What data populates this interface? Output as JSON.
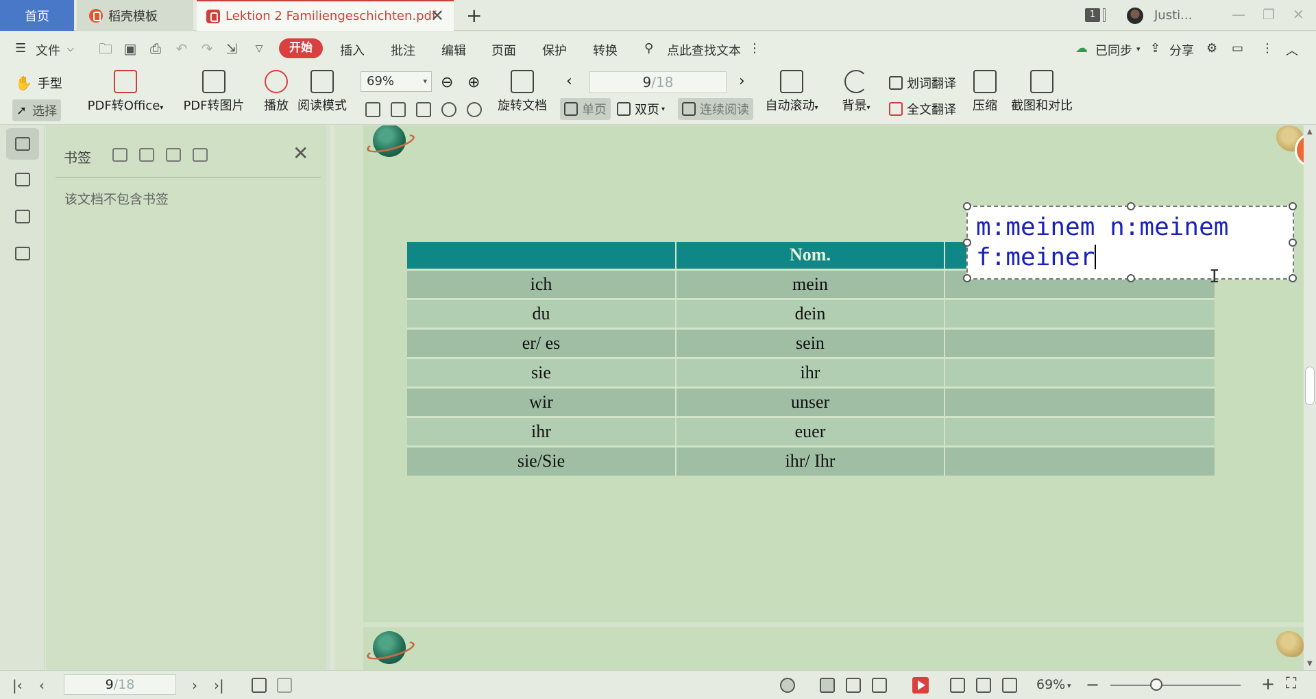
{
  "tabs": {
    "home": "首页",
    "templates": "稻壳模板",
    "document": "Lektion 2 Familiengeschichten.pdf"
  },
  "titlebar": {
    "window_count": "1",
    "user_name": "Justi..."
  },
  "menu": {
    "file": "文件",
    "start": "开始",
    "insert": "插入",
    "annotate": "批注",
    "edit": "编辑",
    "page": "页面",
    "protect": "保护",
    "convert": "转换",
    "search_placeholder": "点此查找文本",
    "sync": "已同步",
    "share": "分享"
  },
  "ribbon": {
    "hand_tool": "手型",
    "select_tool": "选择",
    "pdf_to_office": "PDF转Office",
    "pdf_to_image": "PDF转图片",
    "play": "播放",
    "reading_mode": "阅读模式",
    "zoom_value": "69%",
    "rotate_doc": "旋转文档",
    "page_current": "9",
    "page_total": "/18",
    "single_page": "单页",
    "double_page": "双页",
    "continuous": "连续阅读",
    "auto_scroll": "自动滚动",
    "background": "背景",
    "word_translate": "划词翻译",
    "full_translate": "全文翻译",
    "compress": "压缩",
    "screenshot_compare": "截图和对比"
  },
  "bookmark_panel": {
    "title": "书签",
    "empty_message": "该文档不包含书签"
  },
  "document": {
    "table": {
      "headers": [
        "",
        "Nom.",
        ""
      ],
      "rows": [
        [
          "ich",
          "mein",
          ""
        ],
        [
          "du",
          "dein",
          ""
        ],
        [
          "er/ es",
          "sein",
          ""
        ],
        [
          "sie",
          "ihr",
          ""
        ],
        [
          "wir",
          "unser",
          ""
        ],
        [
          "ihr",
          "euer",
          ""
        ],
        [
          "sie/Sie",
          "ihr/ Ihr",
          ""
        ]
      ]
    },
    "edit_box": {
      "line1": "m:meinem n:meinem",
      "line2": "f:meiner"
    },
    "page_number": "9",
    "text_cursor": "I"
  },
  "statusbar": {
    "page_current": "9",
    "page_total": "/18",
    "zoom": "69%"
  }
}
